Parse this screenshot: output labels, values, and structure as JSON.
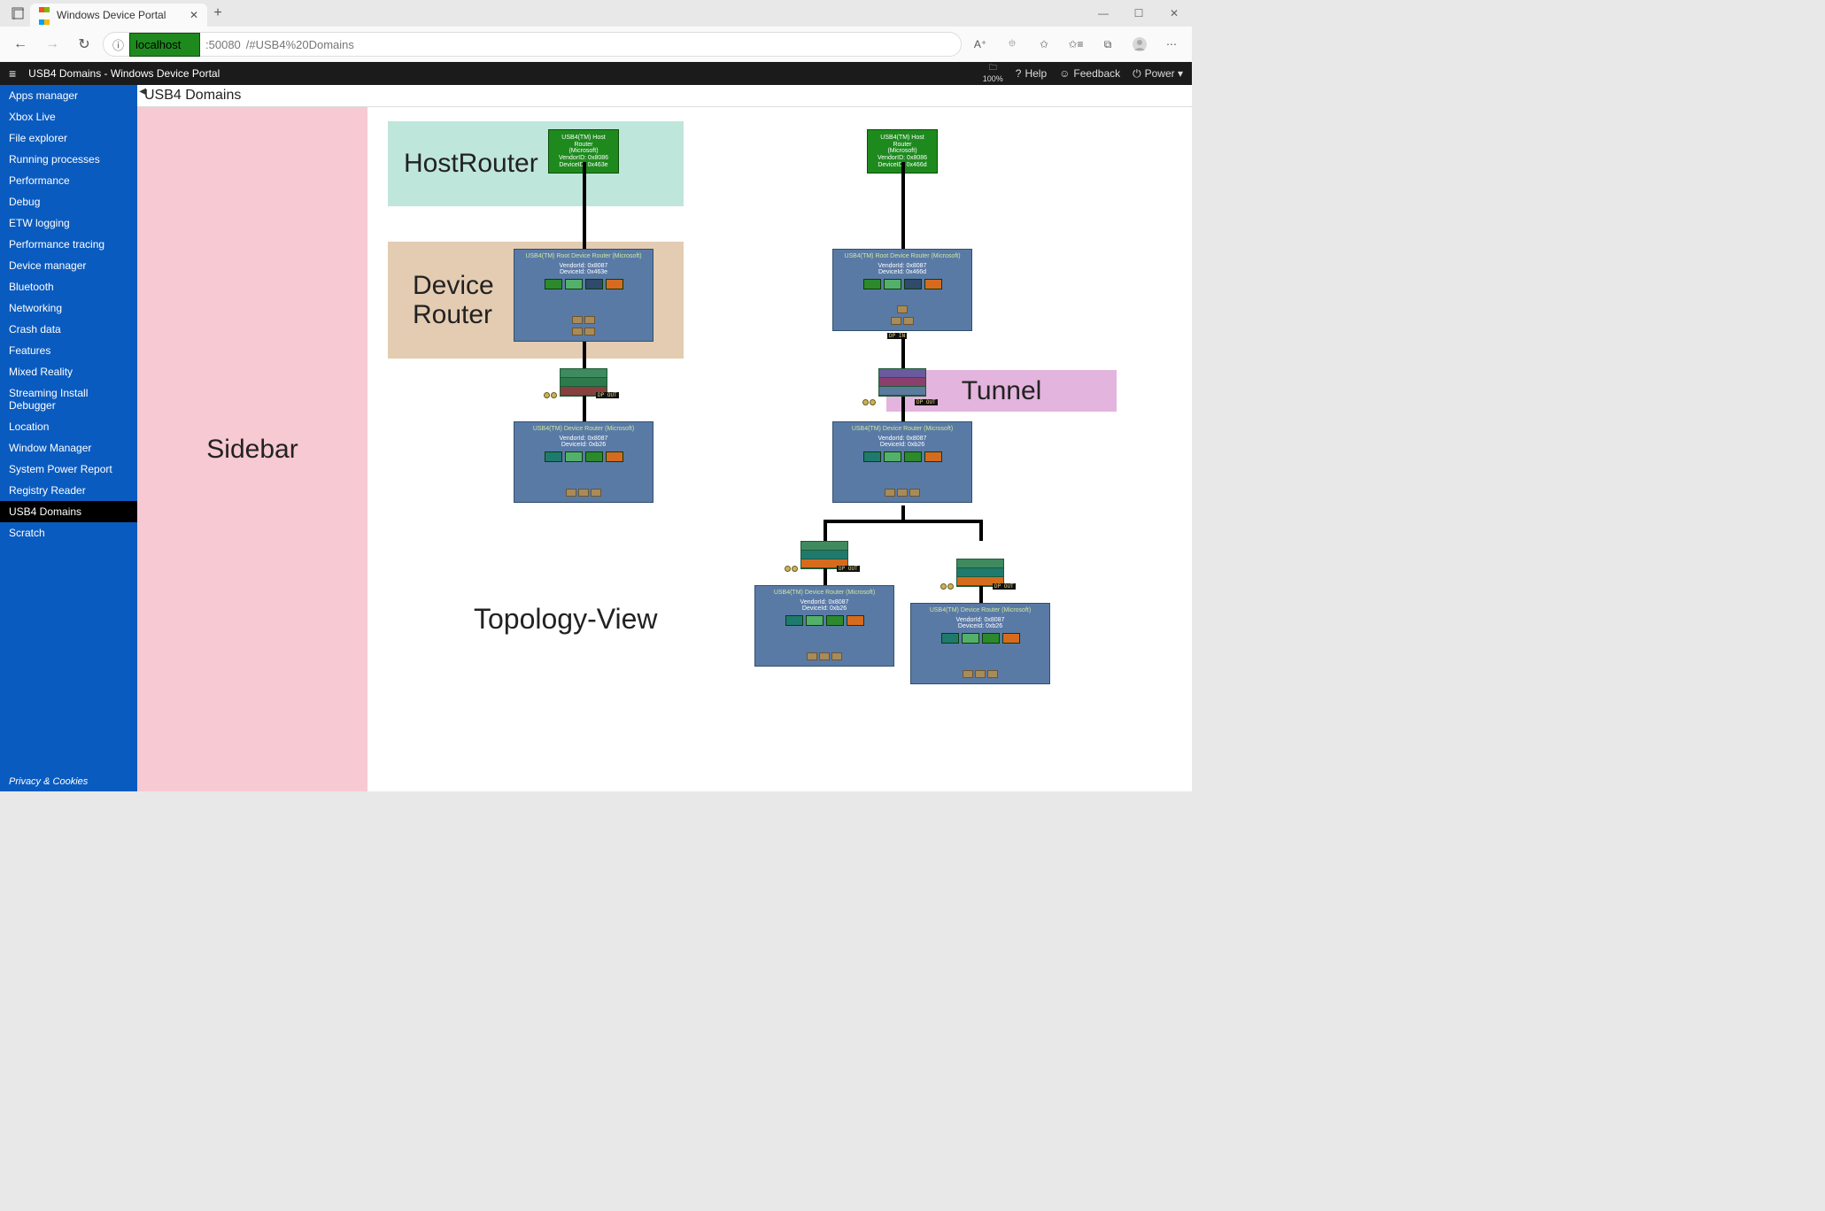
{
  "browser": {
    "tab_title": "Windows Device Portal",
    "new_tab": "+",
    "win_min": "—",
    "win_max": "☐",
    "win_close": "✕",
    "back": "←",
    "forward": "→",
    "reload": "↻",
    "info": "ⓘ",
    "url_host": "localhost",
    "url_port": ":50080",
    "url_path": "/#USB4%20Domains",
    "tb_read": "A⁺",
    "tb_zoom": "⯐",
    "tb_fav": "✩",
    "tb_favlist": "✩≡",
    "tb_collections": "⧉",
    "tb_profile": "●",
    "tb_more": "⋯"
  },
  "appbar": {
    "title": "USB4 Domains - Windows Device Portal",
    "zoom_icon": "🗀",
    "zoom_value": "100%",
    "help": "Help",
    "feedback": "Feedback",
    "power": "Power ▾"
  },
  "sidebar": {
    "items": [
      "Apps manager",
      "Xbox Live",
      "File explorer",
      "Running processes",
      "Performance",
      "Debug",
      "ETW logging",
      "Performance tracing",
      "Device manager",
      "Bluetooth",
      "Networking",
      "Crash data",
      "Features",
      "Mixed Reality",
      "Streaming Install Debugger",
      "Location",
      "Window Manager",
      "System Power Report",
      "Registry Reader",
      "USB4 Domains",
      "Scratch"
    ],
    "active_index": 19,
    "footer": "Privacy & Cookies"
  },
  "page_title": "USB4 Domains",
  "annotations": {
    "sidebar": "Sidebar",
    "hostrouter": "HostRouter",
    "devicerouter": "Device\nRouter",
    "topology": "Topology-View",
    "tunnel": "Tunnel"
  },
  "topology": {
    "left": {
      "host": {
        "l1": "USB4(TM) Host Router",
        "l2": "(Microsoft)",
        "l3": "VendorID: 0x8086",
        "l4": "DeviceID: 0x463e"
      },
      "root": {
        "title": "USB4(TM) Root Device Router (Microsoft)",
        "l2": "VendorId: 0x8087",
        "l3": "DeviceId: 0x463e"
      },
      "dev1": {
        "title": "USB4(TM) Device Router (Microsoft)",
        "l2": "VendorId: 0x8087",
        "l3": "DeviceId: 0xb26"
      },
      "dp_out": "DP OUT"
    },
    "right": {
      "host": {
        "l1": "USB4(TM) Host Router",
        "l2": "(Microsoft)",
        "l3": "VendorID: 0x8086",
        "l4": "DeviceID: 0x466d"
      },
      "root": {
        "title": "USB4(TM) Root Device Router (Microsoft)",
        "l2": "VendorId: 0x8087",
        "l3": "DeviceId: 0x466d"
      },
      "dev1": {
        "title": "USB4(TM) Device Router (Microsoft)",
        "l2": "VendorId: 0x8087",
        "l3": "DeviceId: 0xb26"
      },
      "dev2": {
        "title": "USB4(TM) Device Router (Microsoft)",
        "l2": "VendorId: 0x8087",
        "l3": "DeviceId: 0xb26"
      },
      "dev3": {
        "title": "USB4(TM) Device Router (Microsoft)",
        "l2": "VendorId: 0x8087",
        "l3": "DeviceId: 0xb26"
      },
      "dp_in": "DP IN",
      "dp_out": "DP OUT"
    }
  }
}
